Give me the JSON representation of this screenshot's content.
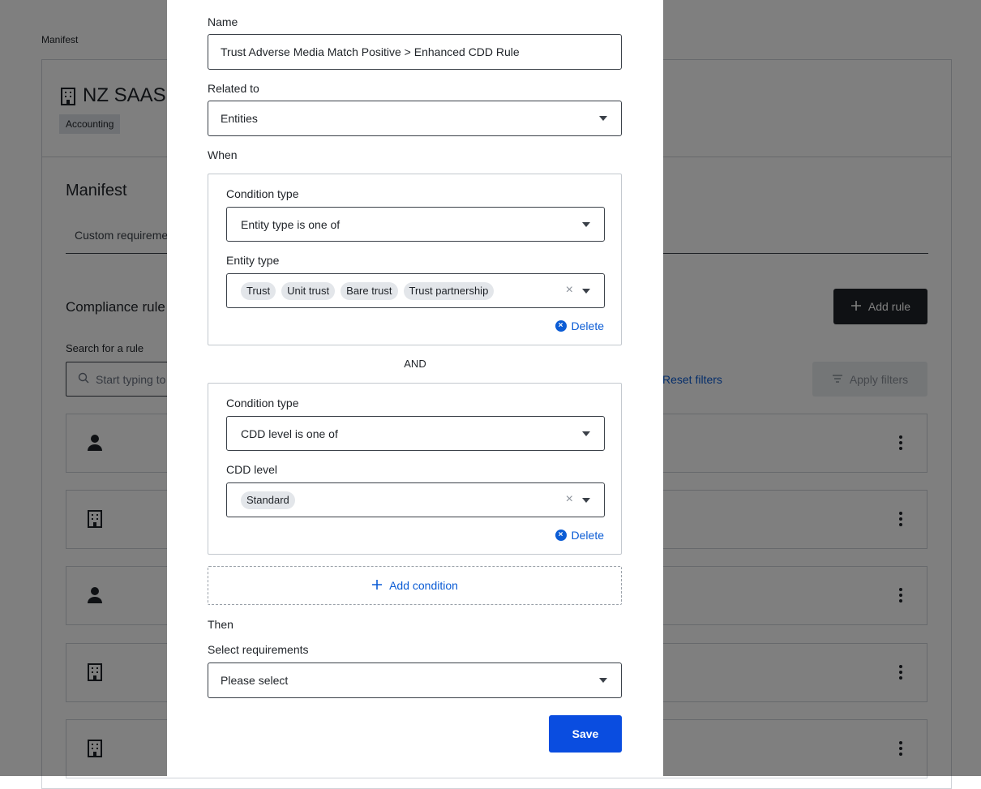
{
  "background": {
    "breadcrumb": "Manifest",
    "org_name": "NZ SAAS",
    "org_tag": "Accounting",
    "section_title": "Manifest",
    "tab_label": "Custom requireme",
    "compliance_title": "Compliance rule",
    "add_rule_label": "Add rule",
    "search_label": "Search for a rule",
    "search_placeholder": "Start typing to",
    "reset_filters_label": "Reset filters",
    "apply_filters_label": "Apply filters",
    "rule_rows": [
      {
        "icon": "person-icon"
      },
      {
        "icon": "building-icon"
      },
      {
        "icon": "person-icon"
      },
      {
        "icon": "building-icon"
      },
      {
        "icon": "building-icon"
      }
    ]
  },
  "modal": {
    "name_label": "Name",
    "name_value": "Trust Adverse Media Match Positive > Enhanced CDD Rule",
    "related_label": "Related to",
    "related_value": "Entities",
    "when_label": "When",
    "conditions": [
      {
        "type_label": "Condition type",
        "type_value": "Entity type is one of",
        "values_label": "Entity type",
        "values": [
          "Trust",
          "Unit trust",
          "Bare trust",
          "Trust partnership"
        ],
        "delete_label": "Delete"
      },
      {
        "type_label": "Condition type",
        "type_value": "CDD level is one of",
        "values_label": "CDD level",
        "values": [
          "Standard"
        ],
        "delete_label": "Delete"
      }
    ],
    "and_label": "AND",
    "add_condition_label": "Add condition",
    "then_label": "Then",
    "requirements_label": "Select requirements",
    "requirements_placeholder": "Please select",
    "save_label": "Save"
  },
  "colors": {
    "accent": "#0b5cd5",
    "primary_button": "#0a4de0",
    "dark_button": "#1f2328"
  }
}
